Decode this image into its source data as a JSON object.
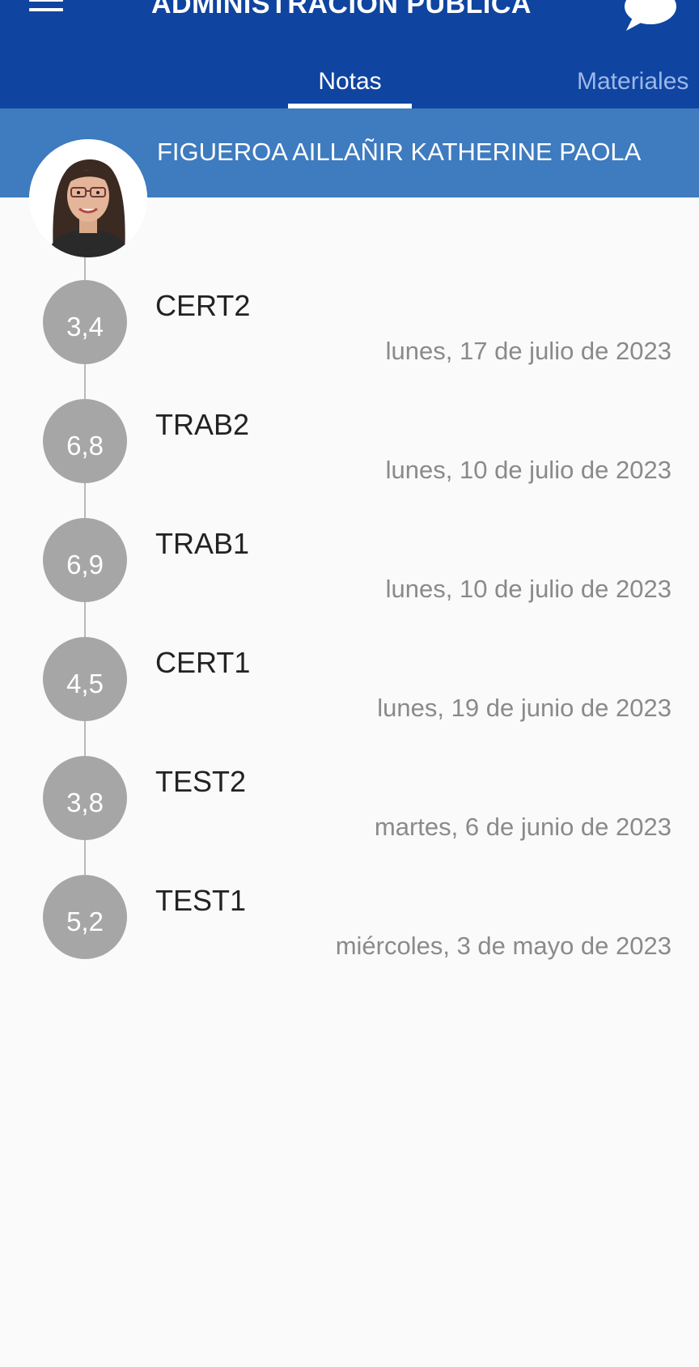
{
  "header": {
    "title": "ADMINISTRACIÓN PÚBLICA",
    "menu_icon": "hamburger-menu-icon",
    "chat_icon": "chat-bubble-icon",
    "bar_color": "#0f44a0"
  },
  "tabs": [
    {
      "label": "Notas",
      "active": true
    },
    {
      "label": "Materiales",
      "active": false
    }
  ],
  "student": {
    "name": "FIGUEROA AILLAÑIR KATHERINE PAOLA",
    "bar_color": "#3e7bbf"
  },
  "grades": [
    {
      "grade": "3,4",
      "name": "CERT2",
      "date": "lunes, 17 de julio de 2023"
    },
    {
      "grade": "6,8",
      "name": "TRAB2",
      "date": "lunes, 10 de julio de 2023"
    },
    {
      "grade": "6,9",
      "name": "TRAB1",
      "date": "lunes, 10 de julio de 2023"
    },
    {
      "grade": "4,5",
      "name": "CERT1",
      "date": "lunes, 19 de junio de 2023"
    },
    {
      "grade": "3,8",
      "name": "TEST2",
      "date": "martes, 6 de junio de 2023"
    },
    {
      "grade": "5,2",
      "name": "TEST1",
      "date": "miércoles, 3 de mayo de 2023"
    }
  ]
}
